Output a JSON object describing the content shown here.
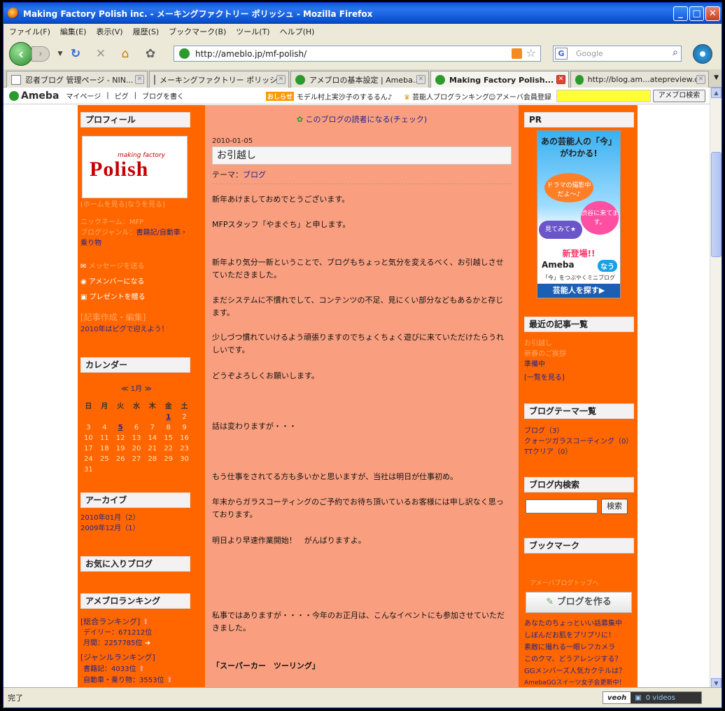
{
  "window": {
    "title": "Making Factory Polish inc. - メーキングファクトリー ポリッシュ - Mozilla Firefox",
    "minimize": "_",
    "maximize": "□",
    "close": "✕"
  },
  "menu": [
    "ファイル(F)",
    "編集(E)",
    "表示(V)",
    "履歴(S)",
    "ブックマーク(B)",
    "ツール(T)",
    "ヘルプ(H)"
  ],
  "nav": {
    "url": "http://ameblo.jp/mf-polish/",
    "search_placeholder": "Google",
    "search_engine": "G"
  },
  "tabs": [
    {
      "label": "忍者ブログ 管理ページ - NIN...",
      "icon": "doc-icon"
    },
    {
      "label": "メーキングファクトリー ポリッシュ",
      "icon": "doc-icon"
    },
    {
      "label": "アメブロの基本設定 | Ameba...",
      "icon": "clover-icon"
    },
    {
      "label": "Making Factory Polish...",
      "icon": "clover-icon",
      "active": true
    },
    {
      "label": "http://blog.am...atepreview.do",
      "icon": "clover-icon"
    }
  ],
  "ameba_bar": {
    "logo": "Ameba",
    "links": [
      "マイページ",
      "|",
      "ピグ",
      "|",
      "ブログを書く"
    ],
    "oshirase_tag": "おしらせ",
    "oshirase": "モデル村上実沙子のするるん♪",
    "ranking": "芸能人ブログランキング",
    "member": "アメーバ会員登録",
    "search_button": "アメブロ検索"
  },
  "left": {
    "profile_head": "プロフィール",
    "profile_brand": "Polish",
    "profile_brand_small": "making factory",
    "profile_links": "[ホームを見る|なうを見る]",
    "nickname": "ニックネーム：MFP",
    "genre_label": "ブログジャンル：",
    "genre_value": "書籍記/自動車・乗り物",
    "message": "メッセージを送る",
    "member": "アメンバーになる",
    "present": "プレゼントを贈る",
    "edit": "[記事作成・編集]",
    "pigg": "2010年はピグで迎えよう！",
    "calendar_head": "カレンダー",
    "calendar_nav": "≪ 1月 ≫",
    "calendar_days": [
      "日",
      "月",
      "火",
      "水",
      "木",
      "金",
      "土"
    ],
    "calendar_rows": [
      [
        "",
        "",
        "",
        "",
        "",
        "1",
        "2"
      ],
      [
        "3",
        "4",
        "5",
        "6",
        "7",
        "8",
        "9"
      ],
      [
        "10",
        "11",
        "12",
        "13",
        "14",
        "15",
        "16"
      ],
      [
        "17",
        "18",
        "19",
        "20",
        "21",
        "22",
        "23"
      ],
      [
        "24",
        "25",
        "26",
        "27",
        "28",
        "29",
        "30"
      ],
      [
        "31",
        "",
        "",
        "",
        "",
        "",
        ""
      ]
    ],
    "archive_head": "アーカイブ",
    "archive": [
      "2010年01月（2）",
      "2009年12月（1）"
    ],
    "fav_head": "お気に入りブログ",
    "ranking_head": "アメブロランキング",
    "rank_total": "[総合ランキング]",
    "rank_daily": "デイリー：671212位",
    "rank_monthly": "月間：2257785位",
    "rank_genre": "[ジャンルランキング]",
    "rank_book": "書籍記：4033位",
    "rank_car": "自動車・乗り物：3553位"
  },
  "center": {
    "reader": "このブログの読者になる(チェック)",
    "date": "2010-01-05",
    "title": "お引越し",
    "theme_label": "テーマ：",
    "theme_link": "ブログ",
    "paragraphs": [
      "新年あけましておめでとうございます。",
      "MFPスタッフ「やまぐち」と申します。",
      "新年より気分一新ということで、ブログもちょっと気分を変えるべく、お引越しさせていただきました。",
      "まだシステムに不慣れでして、コンテンツの不足、見にくい部分などもあるかと存じます。",
      "少しづつ慣れていけるよう頑張りますのでちょくちょく遊びに来ていただけたらうれしいです。",
      "どうぞよろしくお願いします。",
      "話は変わりますが・・・",
      "もう仕事をされてる方も多いかと思いますが、当社は明日が仕事初め。",
      "年末からガラスコーティングのご予約でお待ち頂いているお客様には申し訳なく思っております。",
      "明日より早速作業開始！　がんばりますよ。",
      "私事ではありますが・・・・今年のお正月は、こんなイベントにも参加させていただきました。",
      "「スーパーカー　ツーリング」"
    ]
  },
  "right": {
    "pr_head": "PR",
    "banner": {
      "line1": "あの芸能人の「今」がわかる!",
      "bubble1": "ドラマの撮影中だよ〜♪",
      "bubble2": "渋谷に来てます。",
      "bubble3": "見てみて★",
      "new": "新登場!!",
      "ameba": "Ameba",
      "now": "なう",
      "sub": "「今」をつぶやくミニブログ",
      "cta": "芸能人を探す▶"
    },
    "recent_head": "最近の記事一覧",
    "recent": [
      "お引越し",
      "新春のご挨拶",
      "準備中"
    ],
    "recent_more": "[一覧を見る]",
    "theme_head": "ブログテーマ一覧",
    "themes": [
      "ブログ（3）",
      "クォーツガラスコーティング（0）",
      "TTクリア（0）"
    ],
    "search_head": "ブログ内検索",
    "search_button": "検索",
    "bookmark_head": "ブックマーク",
    "bookmark_note": "アメーバブログトップへ",
    "make_blog": "ブログを作る",
    "ads": [
      "あなたのちょっといい話募集中",
      "しぼんだお肌をプリプリに！",
      "素敵に撮れる一眼レフカメラ",
      "このクマ、どうアレンジする？",
      "GGメンバーズ人気カクテルは？",
      "AmebaGGスイーツ女子会更新中！"
    ]
  },
  "status": {
    "text": "完了",
    "veoh": "veoh",
    "videos": "0  videos"
  }
}
